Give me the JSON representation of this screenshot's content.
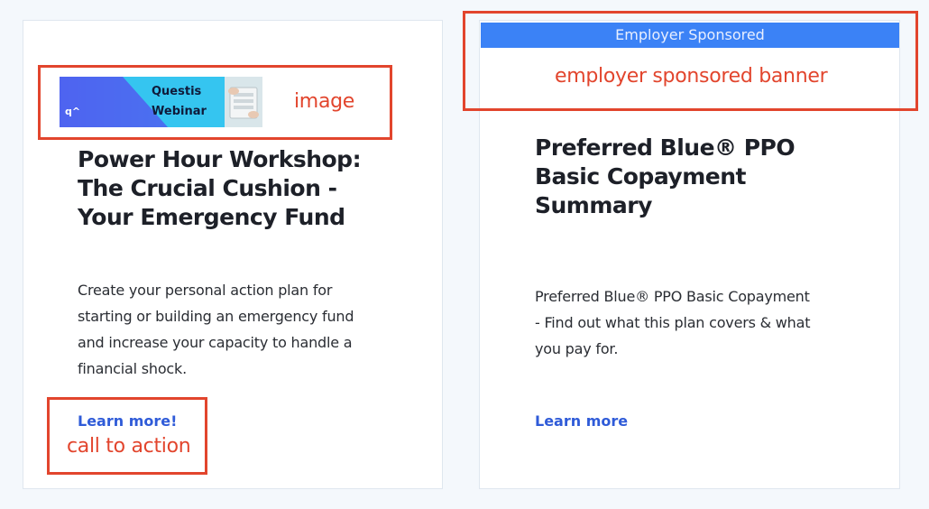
{
  "cards": [
    {
      "image": {
        "logo_text": "q^",
        "title_line1": "Questis",
        "title_line2": "Webinar"
      },
      "title_lines": [
        "Power Hour Workshop:",
        "The Crucial Cushion -",
        "Your Emergency Fund"
      ],
      "description_lines": [
        "Create your personal action plan for",
        "starting or building an emergency fund",
        "and increase your capacity to handle a",
        "financial shock."
      ],
      "cta_label": "Learn more!"
    },
    {
      "banner_text": "Employer Sponsored",
      "title_lines": [
        "Preferred Blue® PPO",
        "Basic Copayment",
        "Summary"
      ],
      "description_lines": [
        "Preferred Blue® PPO Basic Copayment",
        "- Find out what this plan covers & what",
        "you pay for."
      ],
      "cta_label": "Learn more"
    }
  ],
  "annotations": {
    "image_label": "image",
    "cta_label": "call to action",
    "banner_label": "employer sponsored banner"
  },
  "colors": {
    "page_background": "#f4f8fc",
    "banner": "#3b82f6",
    "link": "#2f5bd8",
    "annotation": "#e2452d"
  }
}
